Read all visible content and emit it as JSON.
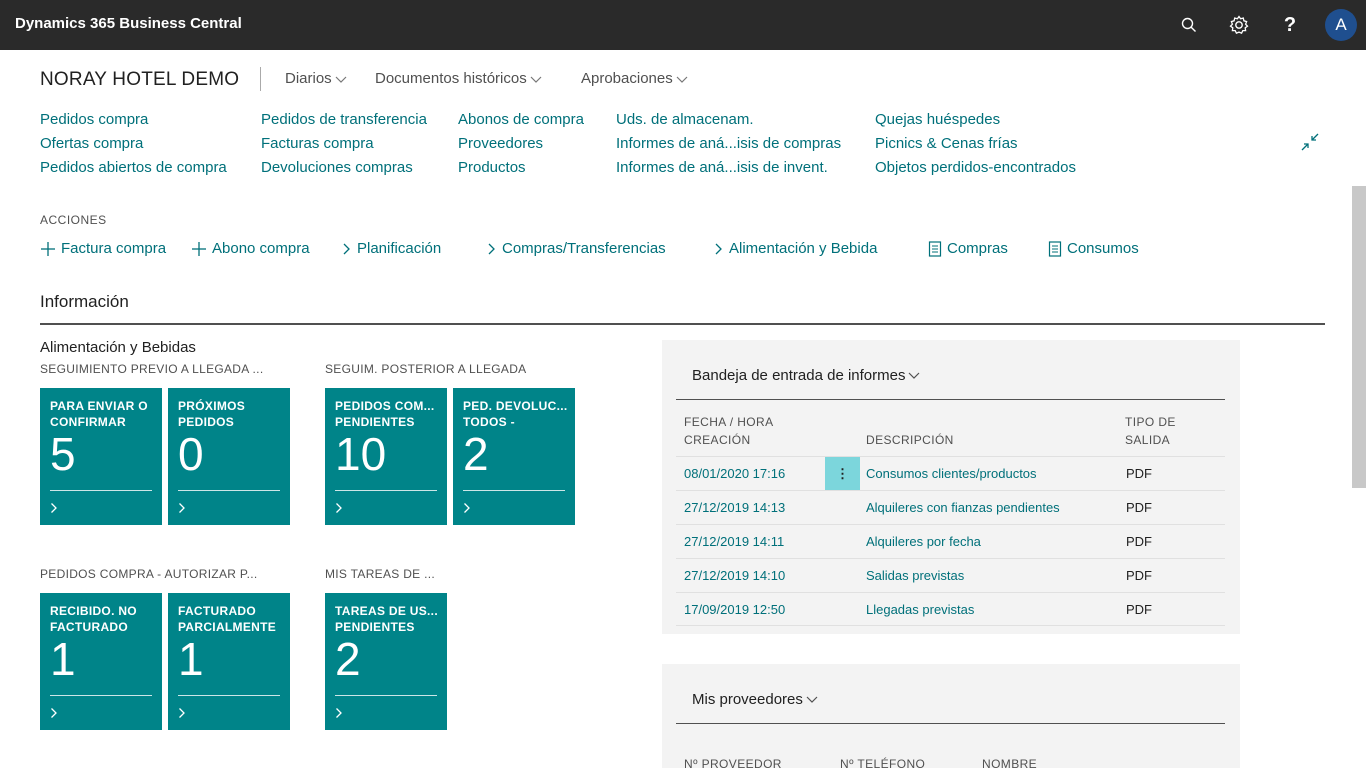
{
  "app": {
    "title": "Dynamics 365 Business Central",
    "avatar": "A"
  },
  "icons": {
    "search": "search-icon",
    "settings": "gear-icon",
    "help": "question-icon",
    "collapse": "collapse-icon"
  },
  "header": {
    "company": "NORAY HOTEL DEMO",
    "menus": [
      "Diarios",
      "Documentos históricos",
      "Aprobaciones"
    ]
  },
  "nav_links": {
    "col1": [
      "Pedidos compra",
      "Ofertas compra",
      "Pedidos abiertos de compra"
    ],
    "col2": [
      "Pedidos de transferencia",
      "Facturas compra",
      "Devoluciones compras"
    ],
    "col3": [
      "Abonos de compra",
      "Proveedores",
      "Productos"
    ],
    "col4": [
      "Uds. de almacenam.",
      "Informes de aná...isis de compras",
      "Informes de aná...isis de invent."
    ],
    "col5": [
      "Quejas huéspedes",
      "Picnics & Cenas frías",
      "Objetos perdidos-encontrados"
    ]
  },
  "actions": {
    "title": "ACCIONES",
    "items": [
      "Factura compra",
      "Abono compra",
      "Planificación",
      "Compras/Transferencias",
      "Alimentación y Bebida",
      "Compras",
      "Consumos"
    ]
  },
  "info": {
    "title": "Información",
    "group_title": "Alimentación y Bebidas",
    "cue_groups": [
      {
        "label": "SEGUIMIENTO PREVIO A LLEGADA ...",
        "tiles": [
          {
            "label": "PARA ENVIAR O CONFIRMAR",
            "value": "5"
          },
          {
            "label": "PRÓXIMOS PEDIDOS",
            "value": "0"
          }
        ]
      },
      {
        "label": "SEGUIM. POSTERIOR A LLEGADA",
        "tiles": [
          {
            "label": "PEDIDOS COM... PENDIENTES",
            "value": "10"
          },
          {
            "label": "PED. DEVOLUC... TODOS -",
            "value": "2"
          }
        ]
      },
      {
        "label": "PEDIDOS COMPRA - AUTORIZAR P...",
        "tiles": [
          {
            "label": "RECIBIDO. NO FACTURADO",
            "value": "1"
          },
          {
            "label": "FACTURADO PARCIALMENTE",
            "value": "1"
          }
        ]
      },
      {
        "label": "MIS TAREAS DE ...",
        "tiles": [
          {
            "label": "TAREAS DE US... PENDIENTES",
            "value": "2"
          }
        ]
      }
    ]
  },
  "report_inbox": {
    "title": "Bandeja de entrada de informes",
    "columns": [
      "FECHA / HORA CREACIÓN",
      "DESCRIPCIÓN",
      "TIPO DE SALIDA"
    ],
    "rows": [
      {
        "date": "08/01/2020 17:16",
        "desc": "Consumos clientes/productos",
        "type": "PDF"
      },
      {
        "date": "27/12/2019 14:13",
        "desc": "Alquileres con fianzas pendientes",
        "type": "PDF"
      },
      {
        "date": "27/12/2019 14:11",
        "desc": "Alquileres por fecha",
        "type": "PDF"
      },
      {
        "date": "27/12/2019 14:10",
        "desc": "Salidas previstas",
        "type": "PDF"
      },
      {
        "date": "17/09/2019 12:50",
        "desc": "Llegadas previstas",
        "type": "PDF"
      }
    ]
  },
  "vendors": {
    "title": "Mis proveedores",
    "columns": [
      "Nº PROVEEDOR",
      "Nº TELÉFONO",
      "NOMBRE"
    ]
  }
}
